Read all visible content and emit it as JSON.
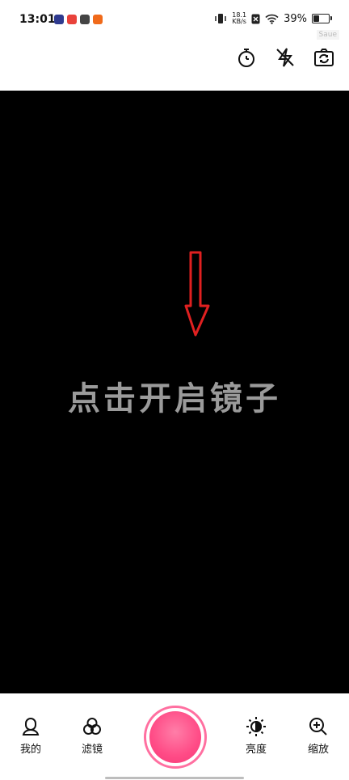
{
  "status_bar": {
    "time": "13:01",
    "net_speed_value": "18.1",
    "net_speed_unit": "KB/s",
    "battery_percent": "39%",
    "battery_level": 0.39,
    "watermark": "Saue",
    "app_badge_colors": [
      "#2f3a8f",
      "#e9423b",
      "#444444",
      "#f06a1a"
    ]
  },
  "toolbar": {
    "timer_icon": "timer-icon",
    "flash_icon": "flash-off-icon",
    "switch_icon": "camera-switch-icon"
  },
  "preview": {
    "hint_text": "点击开启镜子",
    "arrow_color": "#e02020"
  },
  "bottom_nav": {
    "mine": "我的",
    "filter": "滤镜",
    "brightness": "亮度",
    "zoom": "缩放"
  },
  "colors": {
    "shutter": "#ff4b86",
    "shutter_ring": "#ff6fa0"
  }
}
